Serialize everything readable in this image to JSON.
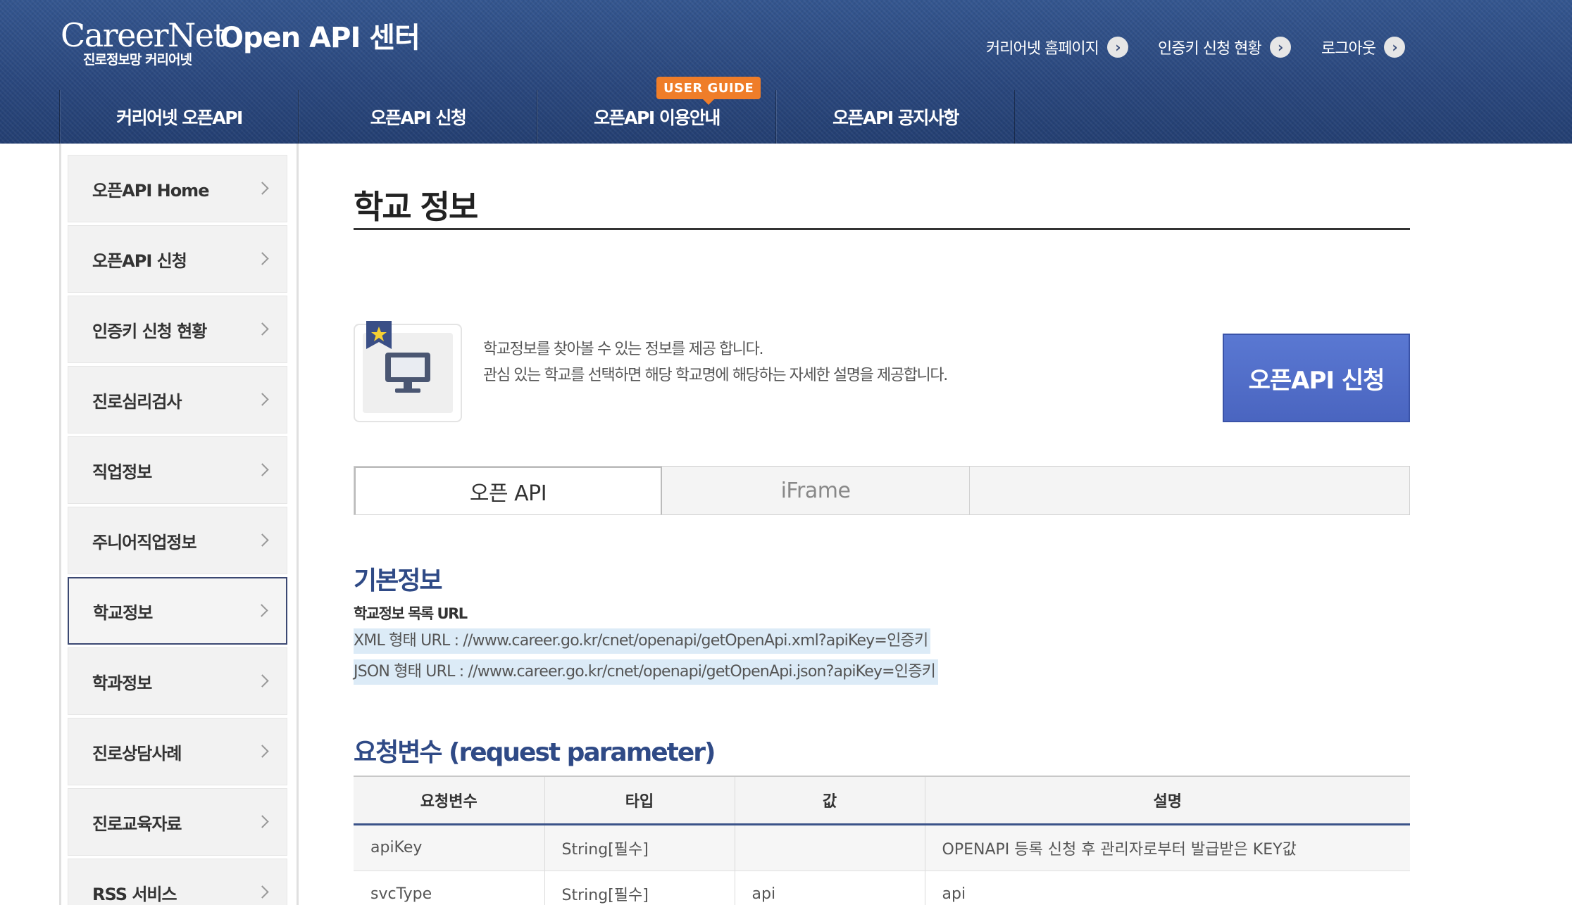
{
  "header": {
    "logo_text": "CareerNet",
    "logo_subtitle": "진로정보망 커리어넷",
    "app_title": "Open API 센터",
    "util_links": [
      "커리어넷 홈페이지",
      "인증키 신청 현황",
      "로그아웃"
    ],
    "util_icon": "chevron-circle-right-icon"
  },
  "gnb": {
    "items": [
      "커리어넷 오픈API",
      "오픈API 신청",
      "오픈API 이용안내",
      "오픈API 공지사항"
    ],
    "badge": "USER GUIDE"
  },
  "sidebar": {
    "items": [
      {
        "label": "오픈API Home",
        "active": false
      },
      {
        "label": "오픈API 신청",
        "active": false
      },
      {
        "label": "인증키 신청 현황",
        "active": false
      },
      {
        "label": "진로심리검사",
        "active": false
      },
      {
        "label": "직업정보",
        "active": false
      },
      {
        "label": "주니어직업정보",
        "active": false
      },
      {
        "label": "학교정보",
        "active": true
      },
      {
        "label": "학과정보",
        "active": false
      },
      {
        "label": "진로상담사례",
        "active": false
      },
      {
        "label": "진로교육자료",
        "active": false
      },
      {
        "label": "RSS 서비스",
        "active": false
      }
    ]
  },
  "main": {
    "page_title": "학교 정보",
    "intro_icon": "monitor-icon",
    "intro_lines": [
      "학교정보를 찾아볼 수 있는 정보를 제공 합니다.",
      "관심 있는 학교를 선택하면 해당 학교명에 해당하는 자세한 설명을 제공합니다."
    ],
    "apply_button": "오픈API 신청",
    "tabs": [
      {
        "label": "오픈 API",
        "active": true
      },
      {
        "label": "iFrame",
        "active": false
      }
    ],
    "basic_info": {
      "title": "기본정보",
      "caption": "학교정보 목록 URL",
      "urls": [
        "XML 형태 URL : //www.career.go.kr/cnet/openapi/getOpenApi.xml?apiKey=인증키",
        "JSON 형태 URL : //www.career.go.kr/cnet/openapi/getOpenApi.json?apiKey=인증키"
      ]
    },
    "request_params": {
      "title": "요청변수 (request parameter)",
      "headers": [
        "요청변수",
        "타입",
        "값",
        "설명"
      ],
      "rows": [
        [
          "apiKey",
          "String[필수]",
          "",
          "OPENAPI 등록 신청 후 관리자로부터 발급받은 KEY값"
        ],
        [
          "svcType",
          "String[필수]",
          "api",
          "api"
        ]
      ]
    }
  },
  "colors": {
    "header_bg": "#2c4a82",
    "accent_blue": "#2f4a86",
    "apply_button": "#4a65c0",
    "badge_orange": "#ef7d29",
    "url_highlight": "#dcebf7"
  }
}
